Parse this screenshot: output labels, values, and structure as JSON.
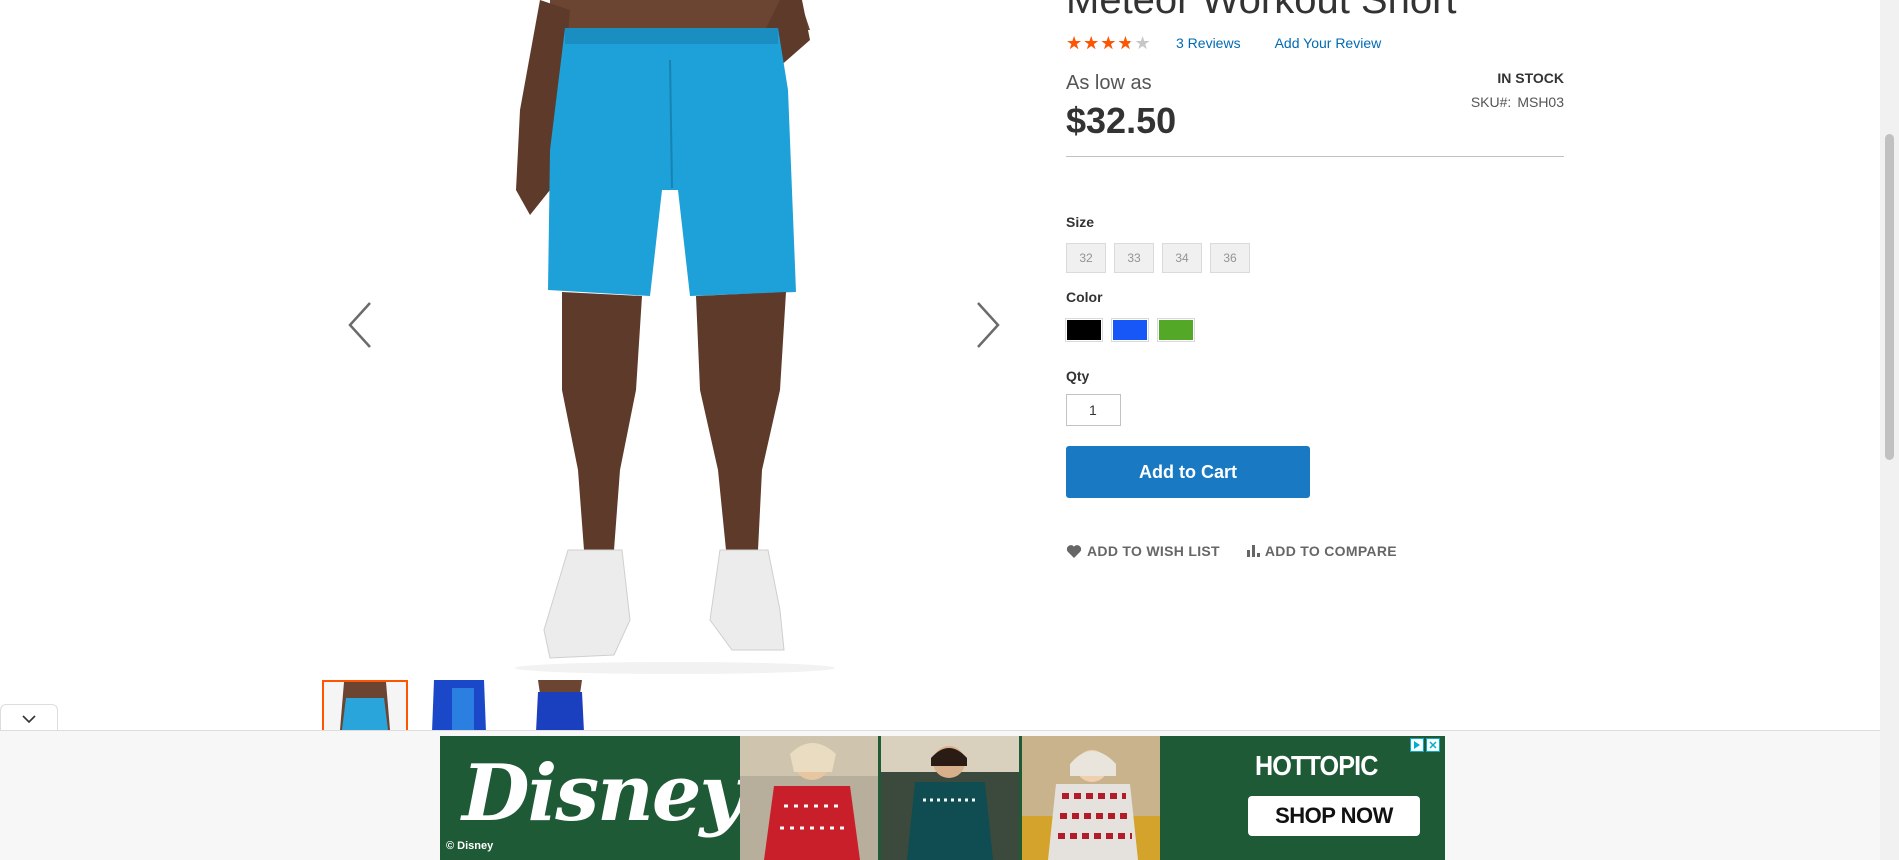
{
  "product": {
    "title": "Meteor Workout Short",
    "rating_fraction": 0.7,
    "reviews_link": "3  Reviews",
    "add_review_link": "Add Your Review",
    "as_low_as_label": "As low as",
    "price": "$32.50",
    "stock_status": "IN STOCK",
    "sku_label": "SKU#:",
    "sku_value": "MSH03"
  },
  "options": {
    "size_label": "Size",
    "sizes": [
      "32",
      "33",
      "34",
      "36"
    ],
    "color_label": "Color",
    "colors": [
      {
        "name": "Black",
        "hex": "#000000"
      },
      {
        "name": "Blue",
        "hex": "#1857f7"
      },
      {
        "name": "Green",
        "hex": "#53a828"
      }
    ],
    "qty_label": "Qty",
    "qty_value": "1"
  },
  "buttons": {
    "add_to_cart": "Add to Cart",
    "wishlist": "ADD TO WISH LIST",
    "compare": "ADD TO COMPARE"
  },
  "gallery": {
    "shorts_color": "#1ea0d8",
    "thumb_colors": [
      "#2aa5dc",
      "#1b48c8",
      "#1a3fbf"
    ]
  },
  "ad": {
    "brand_left": "Disney",
    "copyright": "© Disney",
    "brand_right": "HOTTOPIC",
    "cta": "SHOP NOW"
  }
}
